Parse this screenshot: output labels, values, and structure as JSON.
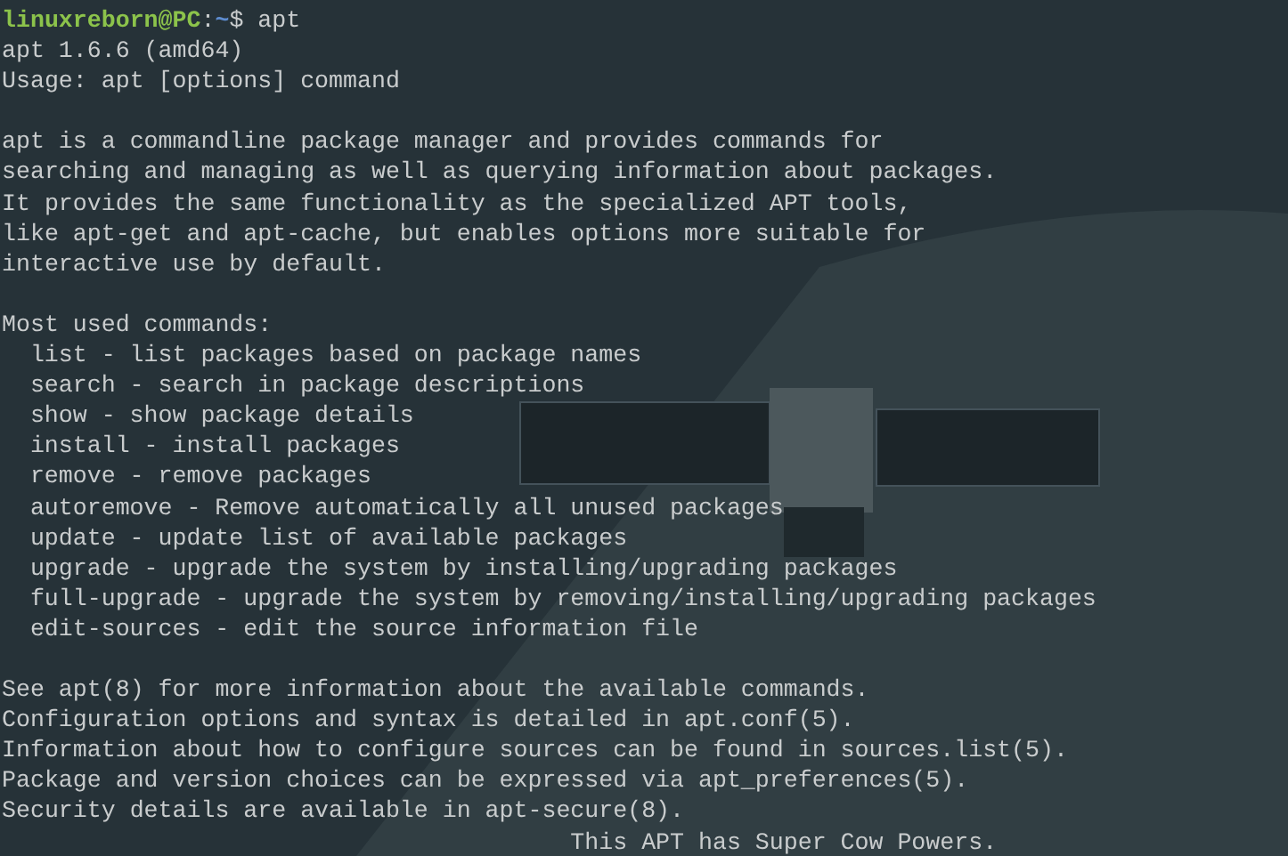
{
  "prompt": {
    "user_host": "linuxreborn@PC",
    "separator": ":",
    "path": "~",
    "symbol": "$",
    "command": "apt"
  },
  "lines": [
    {
      "kind": "plain",
      "text": "apt 1.6.6 (amd64)"
    },
    {
      "kind": "plain",
      "text": "Usage: apt [options] command"
    },
    {
      "kind": "blank"
    },
    {
      "kind": "plain",
      "text": "apt is a commandline package manager and provides commands for"
    },
    {
      "kind": "plain",
      "text": "searching and managing as well as querying information about packages."
    },
    {
      "kind": "plain",
      "text": "It provides the same functionality as the specialized APT tools,"
    },
    {
      "kind": "plain",
      "text": "like apt-get and apt-cache, but enables options more suitable for"
    },
    {
      "kind": "plain",
      "text": "interactive use by default."
    },
    {
      "kind": "blank"
    },
    {
      "kind": "plain",
      "text": "Most used commands:"
    },
    {
      "kind": "indented",
      "text": "list - list packages based on package names"
    },
    {
      "kind": "indented",
      "text": "search - search in package descriptions"
    },
    {
      "kind": "indented",
      "text": "show - show package details"
    },
    {
      "kind": "indented",
      "text": "install - install packages"
    },
    {
      "kind": "indented",
      "text": "remove - remove packages"
    },
    {
      "kind": "indented",
      "text": "autoremove - Remove automatically all unused packages"
    },
    {
      "kind": "indented",
      "text": "update - update list of available packages"
    },
    {
      "kind": "indented",
      "text": "upgrade - upgrade the system by installing/upgrading packages"
    },
    {
      "kind": "indented",
      "text": "full-upgrade - upgrade the system by removing/installing/upgrading packages"
    },
    {
      "kind": "indented",
      "text": "edit-sources - edit the source information file"
    },
    {
      "kind": "blank"
    },
    {
      "kind": "plain",
      "text": "See apt(8) for more information about the available commands."
    },
    {
      "kind": "plain",
      "text": "Configuration options and syntax is detailed in apt.conf(5)."
    },
    {
      "kind": "plain",
      "text": "Information about how to configure sources can be found in sources.list(5)."
    },
    {
      "kind": "plain",
      "text": "Package and version choices can be expressed via apt_preferences(5)."
    },
    {
      "kind": "plain",
      "text": "Security details are available in apt-secure(8)."
    },
    {
      "kind": "footer",
      "text": "This APT has Super Cow Powers."
    }
  ]
}
